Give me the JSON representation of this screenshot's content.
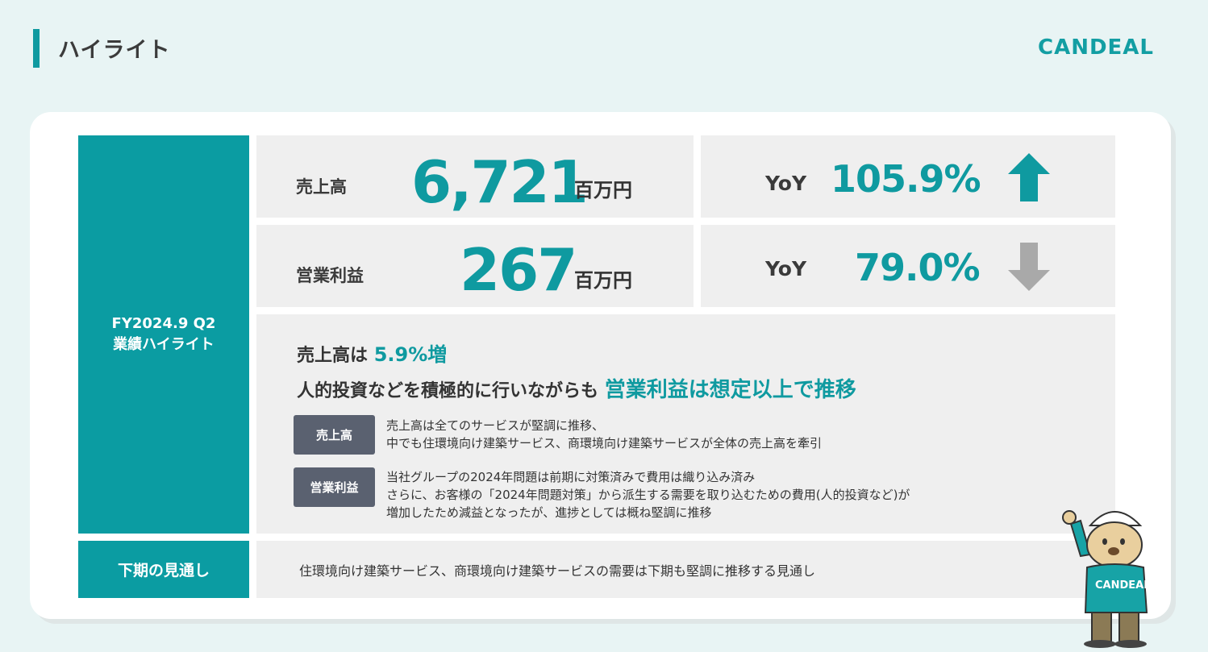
{
  "header": {
    "title": "ハイライト",
    "logo": "CANDEAL"
  },
  "sidebar": {
    "period": "FY2024.9 Q2",
    "period_label": "業績ハイライト",
    "outlook_label": "下期の見通し"
  },
  "kpis": [
    {
      "label": "売上高",
      "value": "6,721",
      "unit": "百万円",
      "yoy_label": "YoY",
      "yoy": "105.9%",
      "trend": "up",
      "color": "#0f9aa0"
    },
    {
      "label": "営業利益",
      "value": "267",
      "unit": "百万円",
      "yoy_label": "YoY",
      "yoy": "79.0%",
      "trend": "down",
      "color": "#a9a9a9"
    }
  ],
  "summary": {
    "line1_prefix": "売上高は",
    "line1_accent": "5.9%増",
    "line2_prefix": "人的投資などを積極的に行いながらも",
    "line2_accent": "営業利益は想定以上で推移",
    "notes": [
      {
        "tag": "売上高",
        "lines": [
          "売上高は全てのサービスが堅調に推移、",
          "中でも住環境向け建築サービス、商環境向け建築サービスが全体の売上高を牽引"
        ]
      },
      {
        "tag": "営業利益",
        "lines": [
          "当社グループの2024年問題は前期に対策済みで費用は織り込み済み",
          "さらに、お客様の「2024年問題対策」から派生する需要を取り込むための費用(人的投資など)が",
          "増加したため減益となったが、進捗としては概ね堅調に推移"
        ]
      }
    ]
  },
  "outlook": {
    "text": "住環境向け建築サービス、商環境向け建築サービスの需要は下期も堅調に推移する見通し"
  },
  "mascot": {
    "shirt_text": "CANDEAL"
  }
}
